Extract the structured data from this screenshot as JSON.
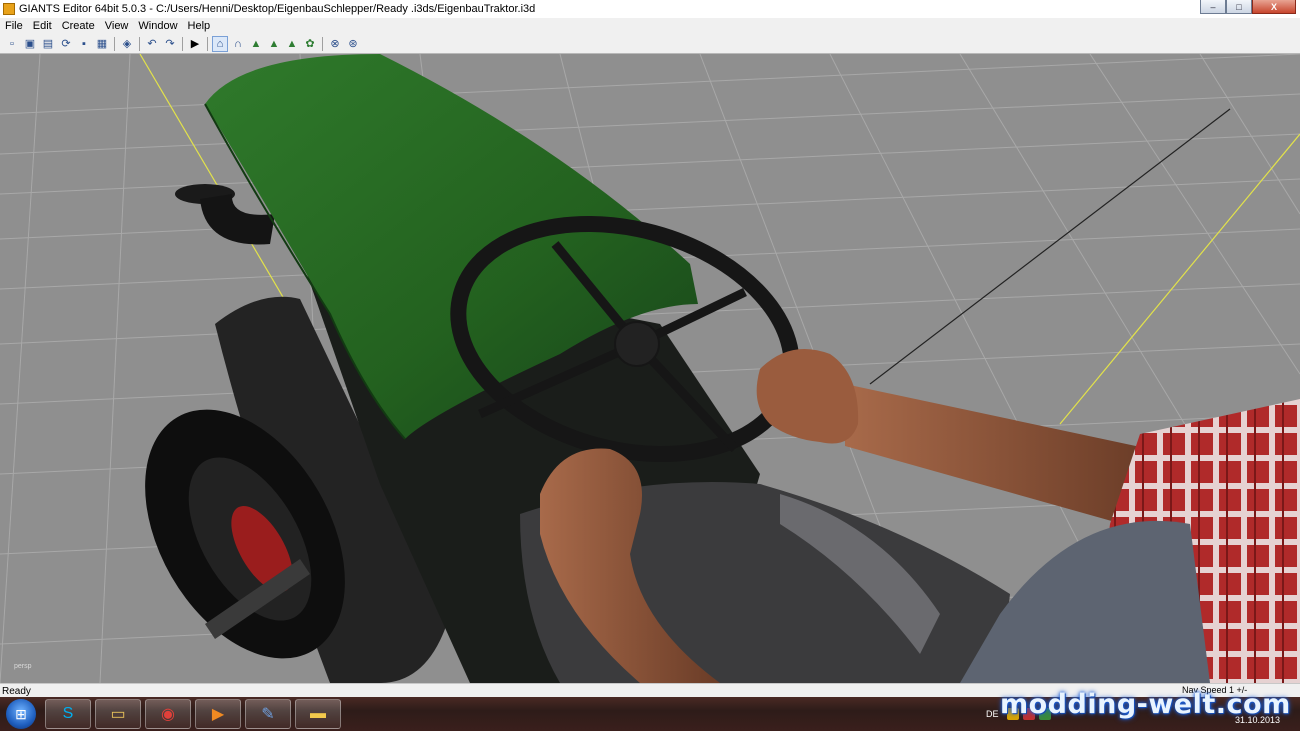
{
  "window": {
    "title": "GIANTS Editor 64bit 5.0.3 - C:/Users/Henni/Desktop/EigenbauSchlepper/Ready .i3ds/EigenbauTraktor.i3d",
    "controls": {
      "minimize": "–",
      "maximize": "□",
      "close": "X"
    }
  },
  "menu": {
    "items": [
      "File",
      "Edit",
      "Create",
      "View",
      "Window",
      "Help"
    ]
  },
  "toolbar": {
    "icons": [
      "new-icon",
      "open-icon",
      "import-icon",
      "reload-icon",
      "save-icon",
      "save-all-icon",
      "export-icon",
      "undo-icon",
      "redo-icon",
      "play-icon",
      "select-icon",
      "move-icon",
      "terrain-paint-icon",
      "terrain-sculpt-icon",
      "foliage-icon",
      "grass-icon",
      "settings-icon",
      "render-icon"
    ],
    "glyphs": [
      "▫",
      "▣",
      "▤",
      "⟳",
      "▪",
      "▦",
      "◈",
      "↶",
      "↷",
      "▶",
      "⌂",
      "∩",
      "▲",
      "▲",
      "▲",
      "✿",
      "⊗",
      "⊛"
    ]
  },
  "viewport": {
    "camera_label": "persp"
  },
  "status": {
    "text": "Ready",
    "nav_speed": "Nav Speed 1 +/-"
  },
  "taskbar": {
    "start_glyph": "⊞",
    "buttons": [
      {
        "name": "skype-task",
        "glyph": "S",
        "color": "#00aff0"
      },
      {
        "name": "explorer-task",
        "glyph": "▭",
        "color": "#e8c25a"
      },
      {
        "name": "chrome-task",
        "glyph": "◉",
        "color": "#e0403a"
      },
      {
        "name": "media-task",
        "glyph": "▶",
        "color": "#f08a22"
      },
      {
        "name": "editor-task",
        "glyph": "✎",
        "color": "#6fa0e0"
      },
      {
        "name": "folder-task",
        "glyph": "▬",
        "color": "#f2c94c"
      }
    ],
    "language": "DE",
    "date": "31.10.2013"
  },
  "watermark": "modding-welt.com",
  "colors": {
    "viewport_bg": "#8f8f8f",
    "grid_line": "#a8a8a8",
    "axis_line": "#e2e24a",
    "tractor_hood": "#2d6b2a",
    "shirt": "#b02a2a"
  }
}
